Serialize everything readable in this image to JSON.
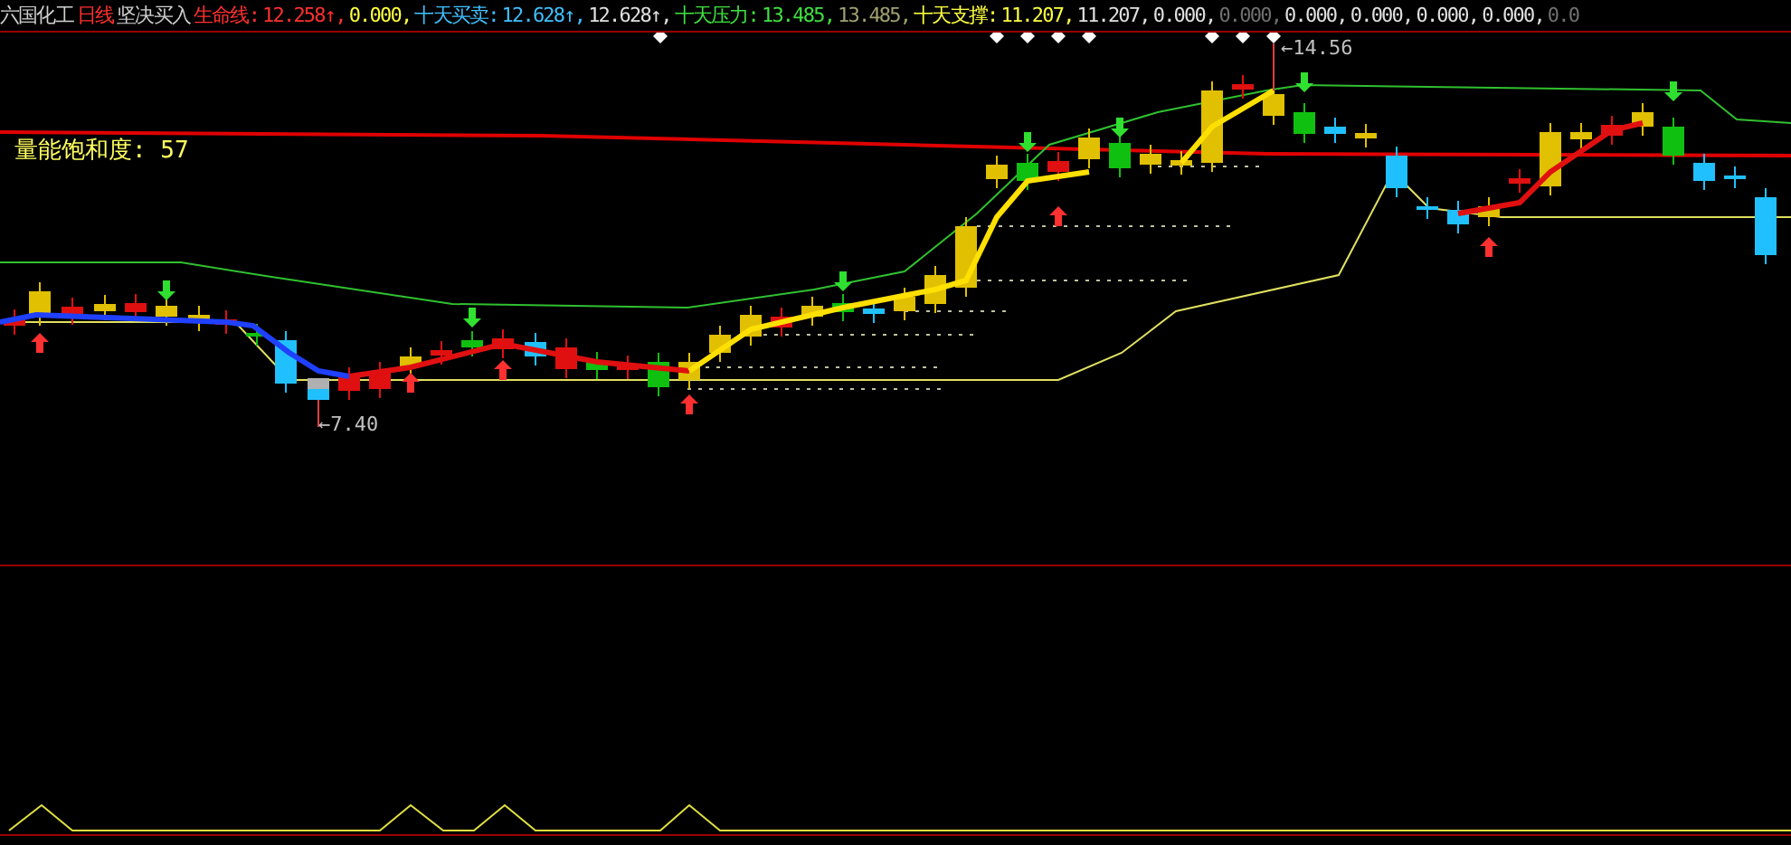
{
  "header": {
    "stock_name": "六国化工",
    "period": "日线",
    "formula_name": "坚决买入",
    "segments": [
      {
        "text": "生命线:",
        "color": "#ff3030"
      },
      {
        "text": "12.258↑,",
        "color": "#ff3030"
      },
      {
        "text": "0.000,",
        "color": "#ffff40"
      },
      {
        "text": "十天买卖:",
        "color": "#40c0ff"
      },
      {
        "text": "12.628↑,",
        "color": "#40c0ff"
      },
      {
        "text": "12.628↑,",
        "color": "#e0e0e0"
      },
      {
        "text": "十天压力:",
        "color": "#40e040"
      },
      {
        "text": "13.485,",
        "color": "#40e040"
      },
      {
        "text": "13.485,",
        "color": "#a0a070"
      },
      {
        "text": "十天支撑:",
        "color": "#ffff40"
      },
      {
        "text": "11.207,",
        "color": "#ffff40"
      },
      {
        "text": "11.207,",
        "color": "#e0e0e0"
      },
      {
        "text": "0.000,",
        "color": "#e0e0e0"
      },
      {
        "text": "0.000,",
        "color": "#707070"
      },
      {
        "text": "0.000,",
        "color": "#e0e0e0"
      },
      {
        "text": "0.000,",
        "color": "#e0e0e0"
      },
      {
        "text": "0.000,",
        "color": "#e0e0e0"
      },
      {
        "text": "0.000,",
        "color": "#e0e0e0"
      },
      {
        "text": "0.0",
        "color": "#707070"
      }
    ]
  },
  "main_chart": {
    "saturation_label": "量能饱和度: 57",
    "high_label": "←14.56",
    "low_label": "←7.40"
  }
}
